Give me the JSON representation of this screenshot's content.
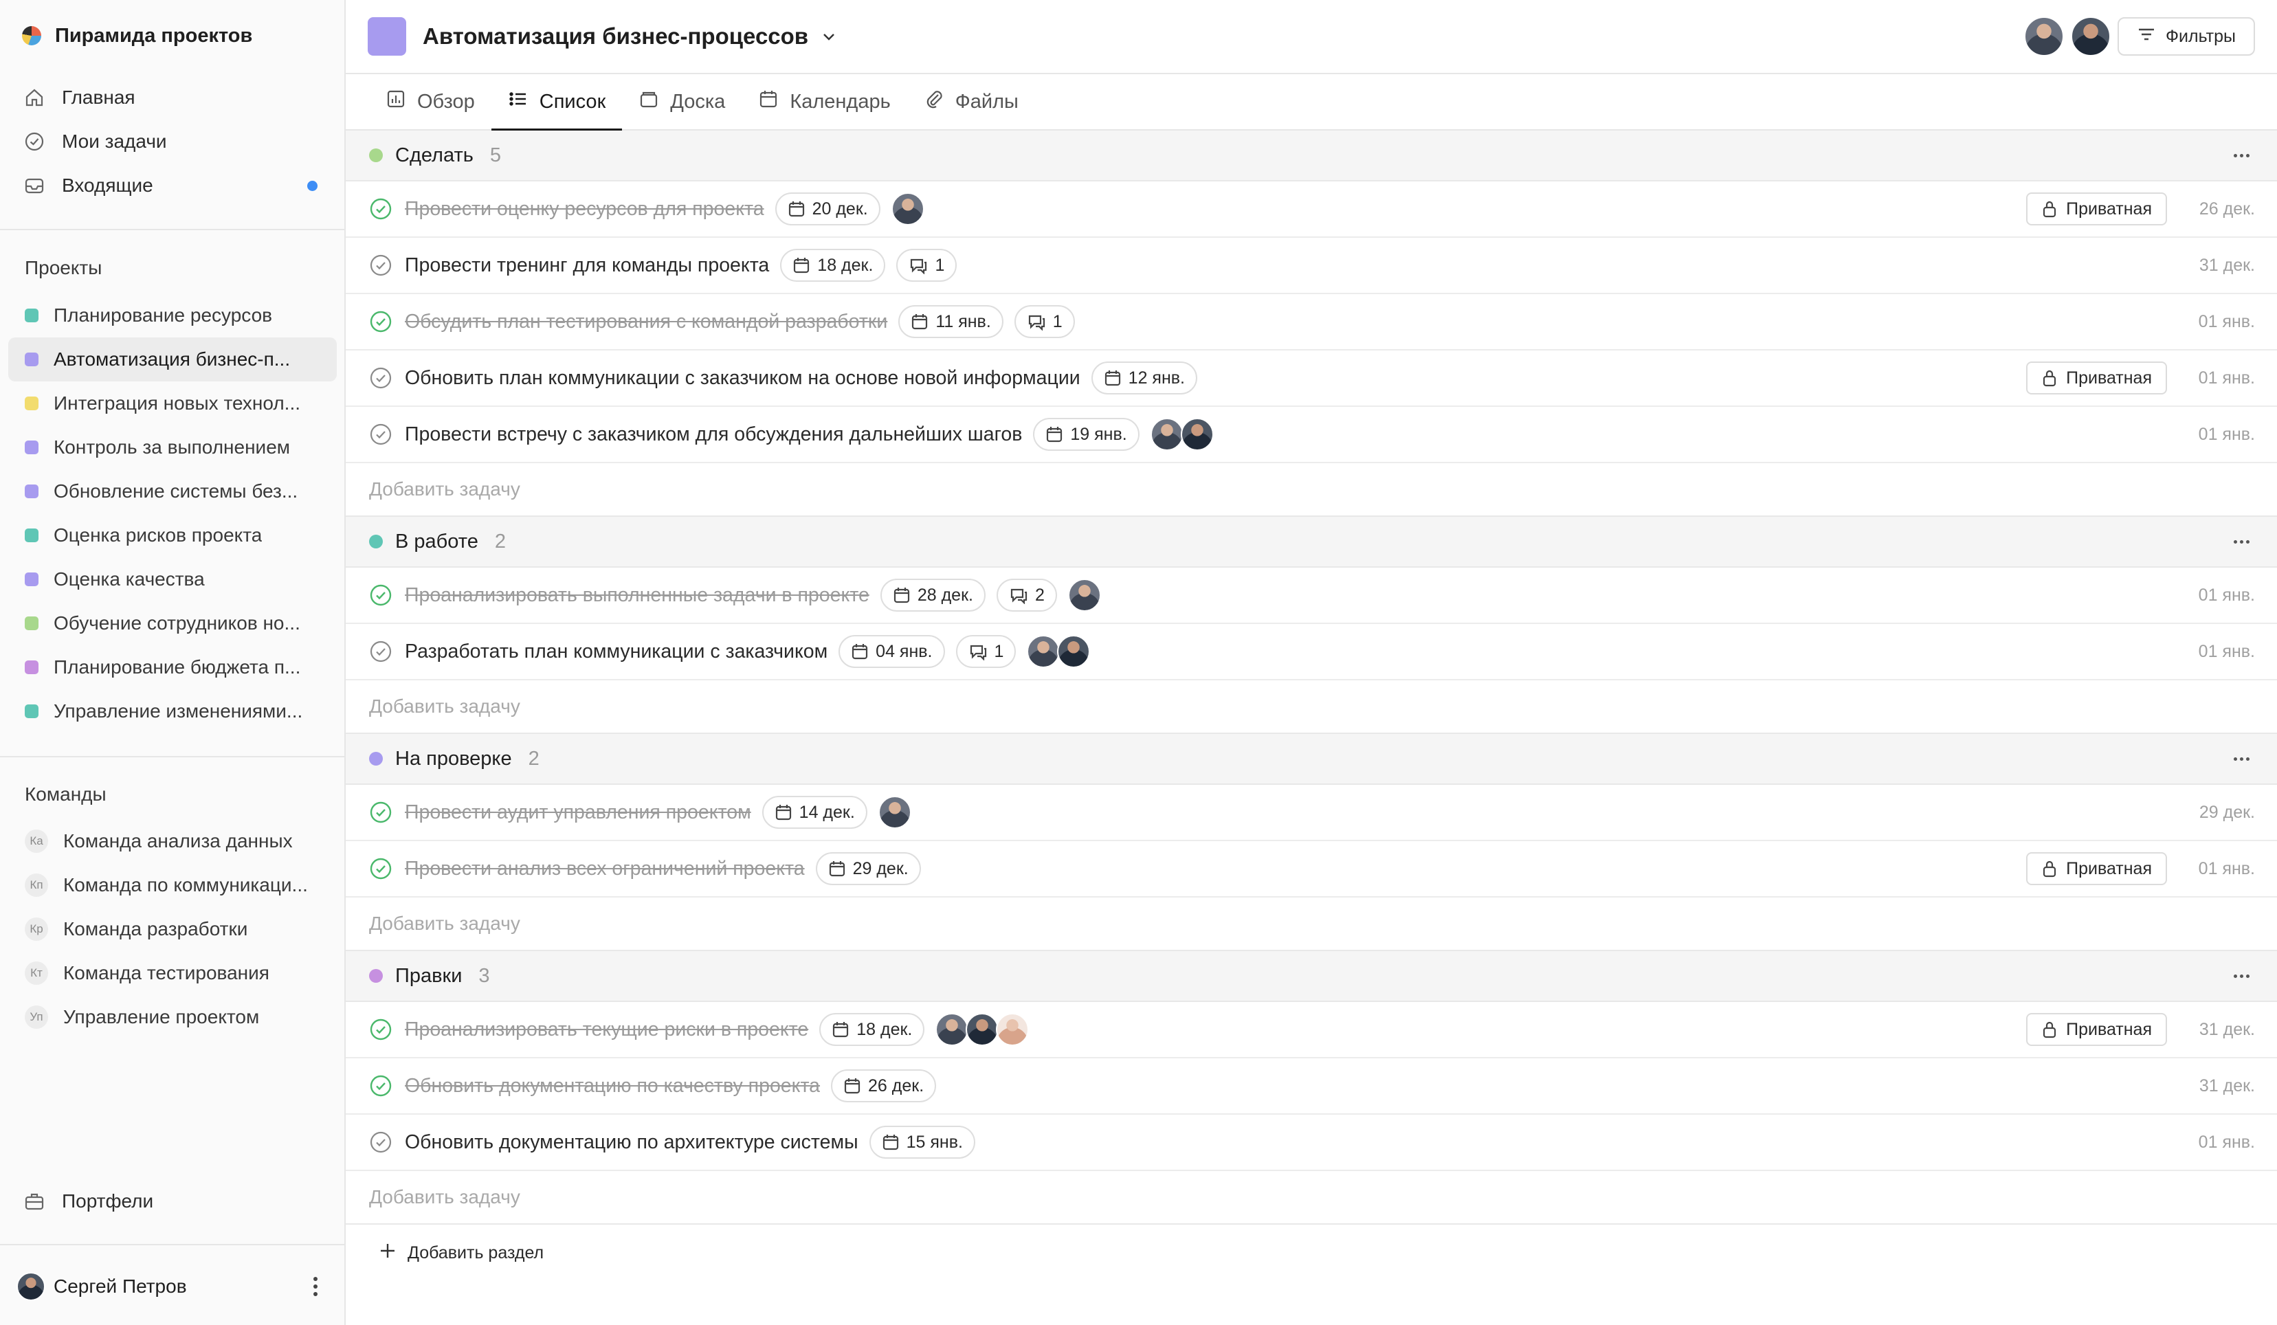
{
  "sidebar": {
    "workspace": "Пирамида проектов",
    "nav": [
      {
        "label": "Главная",
        "icon": "home-icon"
      },
      {
        "label": "Мои задачи",
        "icon": "check-circle-icon"
      },
      {
        "label": "Входящие",
        "icon": "inbox-icon"
      }
    ],
    "projects_title": "Проекты",
    "projects": [
      {
        "label": "Планирование ресурсов",
        "color": "#5fc6b5"
      },
      {
        "label": "Автоматизация бизнес-п...",
        "color": "#a79bef"
      },
      {
        "label": "Интеграция новых технол...",
        "color": "#f2dc6e"
      },
      {
        "label": "Контроль за выполнением",
        "color": "#a79bef"
      },
      {
        "label": "Обновление системы без...",
        "color": "#a79bef"
      },
      {
        "label": "Оценка рисков проекта",
        "color": "#5fc6b5"
      },
      {
        "label": "Оценка качества",
        "color": "#a79bef"
      },
      {
        "label": "Обучение сотрудников но...",
        "color": "#a8d88c"
      },
      {
        "label": "Планирование бюджета п...",
        "color": "#c690e0"
      },
      {
        "label": "Управление изменениями...",
        "color": "#5fc6b5"
      }
    ],
    "teams_title": "Команды",
    "teams": [
      {
        "badge": "Ка",
        "label": "Команда анализа данных"
      },
      {
        "badge": "Кп",
        "label": "Команда по коммуникаци..."
      },
      {
        "badge": "Кр",
        "label": "Команда разработки"
      },
      {
        "badge": "Кт",
        "label": "Команда тестирования"
      },
      {
        "badge": "Уп",
        "label": "Управление проектом"
      }
    ],
    "portfolio": "Портфели",
    "user": "Сергей Петров"
  },
  "header": {
    "title": "Автоматизация бизнес-процессов",
    "filter_label": "Фильтры"
  },
  "tabs": [
    "Обзор",
    "Список",
    "Доска",
    "Календарь",
    "Файлы"
  ],
  "add_task_label": "Добавить задачу",
  "add_section_label": "Добавить раздел",
  "private_label": "Приватная",
  "sections": [
    {
      "name": "Сделать",
      "count": "5",
      "color": "#a8d88c",
      "tasks": [
        {
          "title": "Провести оценку ресурсов для проекта",
          "done": true,
          "due": "20 дек.",
          "comments": "",
          "avatars": 1,
          "private": true,
          "date": "26 дек."
        },
        {
          "title": "Провести тренинг для команды проекта",
          "done": false,
          "due": "18 дек.",
          "comments": "1",
          "avatars": 0,
          "private": false,
          "date": "31 дек."
        },
        {
          "title": "Обсудить план тестирования с командой разработки",
          "done": true,
          "due": "11 янв.",
          "comments": "1",
          "avatars": 0,
          "private": false,
          "date": "01 янв."
        },
        {
          "title": "Обновить план коммуникации с заказчиком на основе новой информации",
          "done": false,
          "due": "12 янв.",
          "comments": "",
          "avatars": 0,
          "private": true,
          "date": "01 янв."
        },
        {
          "title": "Провести встречу с заказчиком для обсуждения дальнейших шагов",
          "done": false,
          "due": "19 янв.",
          "comments": "",
          "avatars": 2,
          "private": false,
          "date": "01 янв."
        }
      ]
    },
    {
      "name": "В работе",
      "count": "2",
      "color": "#5fc6b5",
      "tasks": [
        {
          "title": "Проанализировать выполненные задачи в проекте",
          "done": true,
          "due": "28 дек.",
          "comments": "2",
          "avatars": 1,
          "private": false,
          "date": "01 янв."
        },
        {
          "title": "Разработать план коммуникации с заказчиком",
          "done": false,
          "due": "04 янв.",
          "comments": "1",
          "avatars": 2,
          "private": false,
          "date": "01 янв."
        }
      ]
    },
    {
      "name": "На проверке",
      "count": "2",
      "color": "#a79bef",
      "tasks": [
        {
          "title": "Провести аудит управления проектом",
          "done": true,
          "due": "14 дек.",
          "comments": "",
          "avatars": 1,
          "private": false,
          "date": "29 дек."
        },
        {
          "title": "Провести анализ всех ограничений проекта",
          "done": true,
          "due": "29 дек.",
          "comments": "",
          "avatars": 0,
          "private": true,
          "date": "01 янв."
        }
      ]
    },
    {
      "name": "Правки",
      "count": "3",
      "color": "#c690e0",
      "tasks": [
        {
          "title": "Проанализировать текущие риски в проекте",
          "done": true,
          "due": "18 дек.",
          "comments": "",
          "avatars": 3,
          "private": true,
          "date": "31 дек."
        },
        {
          "title": "Обновить документацию по качеству проекта",
          "done": true,
          "due": "26 дек.",
          "comments": "",
          "avatars": 0,
          "private": false,
          "date": "31 дек."
        },
        {
          "title": "Обновить документацию по архитектуре системы",
          "done": false,
          "due": "15 янв.",
          "comments": "",
          "avatars": 0,
          "private": false,
          "date": "01 янв."
        }
      ]
    }
  ]
}
